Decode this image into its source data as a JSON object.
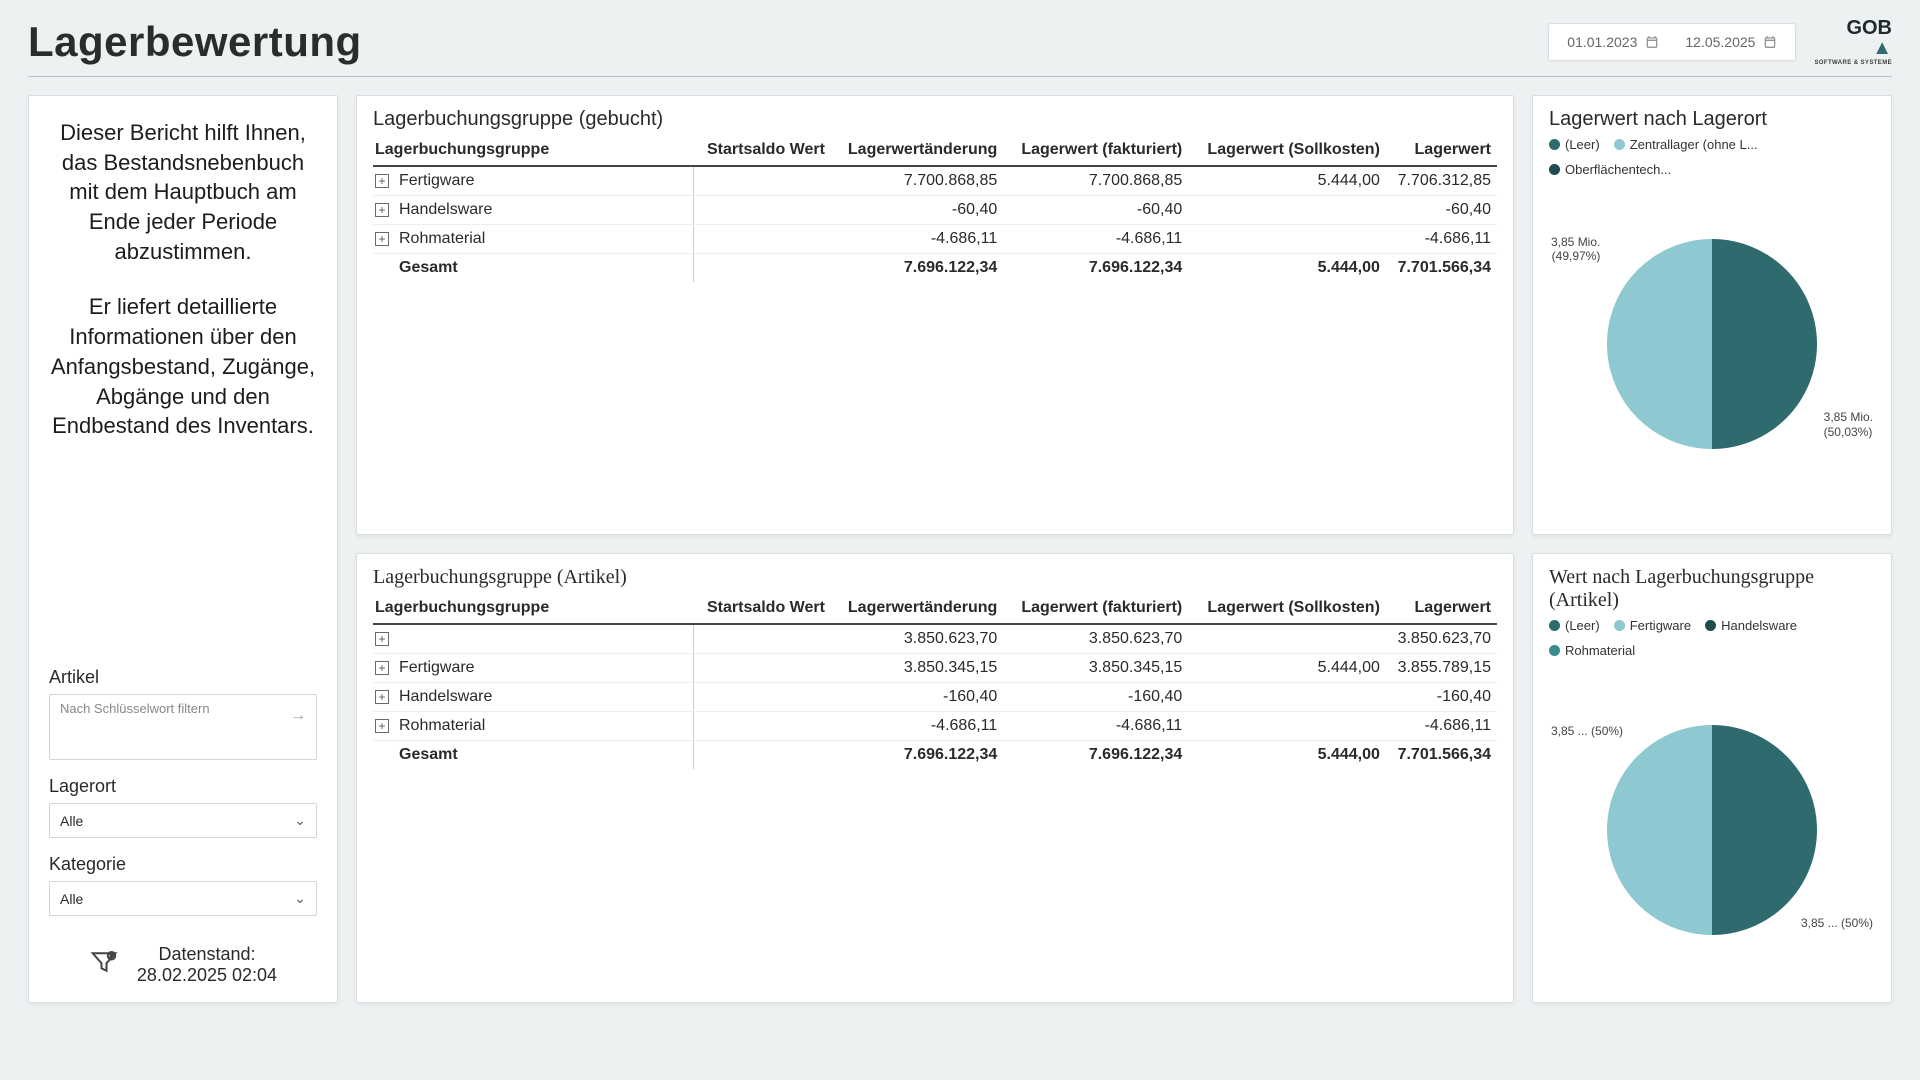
{
  "header": {
    "title": "Lagerbewertung",
    "date_from": "01.01.2023",
    "date_to": "12.05.2025",
    "logo_main": "GOB",
    "logo_sub": "SOFTWARE & SYSTEME"
  },
  "sidebar": {
    "para1": "Dieser Bericht hilft Ihnen, das Bestandsnebenbuch mit dem Hauptbuch am Ende jeder Periode abzustimmen.",
    "para2": "Er liefert detaillierte Informationen über den Anfangsbestand, Zugänge, Abgänge und den Endbestand des Inventars.",
    "article_label": "Artikel",
    "article_placeholder": "Nach Schlüsselwort filtern",
    "location_label": "Lagerort",
    "location_value": "Alle",
    "category_label": "Kategorie",
    "category_value": "Alle",
    "datastand_label": "Datenstand:",
    "datastand_value": "28.02.2025 02:04"
  },
  "table_booked": {
    "title": "Lagerbuchungsgruppe (gebucht)",
    "headers": {
      "group": "Lagerbuchungsgruppe",
      "start": "Startsaldo Wert",
      "change": "Lagerwertänderung",
      "invoiced": "Lagerwert (fakturiert)",
      "target": "Lagerwert (Sollkosten)",
      "total": "Lagerwert"
    },
    "rows": [
      {
        "name": "Fertigware",
        "start": "",
        "change": "7.700.868,85",
        "invoiced": "7.700.868,85",
        "target": "5.444,00",
        "total": "7.706.312,85"
      },
      {
        "name": "Handelsware",
        "start": "",
        "change": "-60,40",
        "invoiced": "-60,40",
        "target": "",
        "total": "-60,40"
      },
      {
        "name": "Rohmaterial",
        "start": "",
        "change": "-4.686,11",
        "invoiced": "-4.686,11",
        "target": "",
        "total": "-4.686,11"
      }
    ],
    "total_row": {
      "name": "Gesamt",
      "start": "",
      "change": "7.696.122,34",
      "invoiced": "7.696.122,34",
      "target": "5.444,00",
      "total": "7.701.566,34"
    }
  },
  "table_article": {
    "title": "Lagerbuchungsgruppe (Artikel)",
    "headers": {
      "group": "Lagerbuchungsgruppe",
      "start": "Startsaldo Wert",
      "change": "Lagerwertänderung",
      "invoiced": "Lagerwert (fakturiert)",
      "target": "Lagerwert (Sollkosten)",
      "total": "Lagerwert"
    },
    "rows": [
      {
        "name": "",
        "start": "",
        "change": "3.850.623,70",
        "invoiced": "3.850.623,70",
        "target": "",
        "total": "3.850.623,70"
      },
      {
        "name": "Fertigware",
        "start": "",
        "change": "3.850.345,15",
        "invoiced": "3.850.345,15",
        "target": "5.444,00",
        "total": "3.855.789,15"
      },
      {
        "name": "Handelsware",
        "start": "",
        "change": "-160,40",
        "invoiced": "-160,40",
        "target": "",
        "total": "-160,40"
      },
      {
        "name": "Rohmaterial",
        "start": "",
        "change": "-4.686,11",
        "invoiced": "-4.686,11",
        "target": "",
        "total": "-4.686,11"
      }
    ],
    "total_row": {
      "name": "Gesamt",
      "start": "",
      "change": "7.696.122,34",
      "invoiced": "7.696.122,34",
      "target": "5.444,00",
      "total": "7.701.566,34"
    }
  },
  "pie_location": {
    "title": "Lagerwert nach Lagerort",
    "legend": [
      {
        "label": "(Leer)",
        "color": "#2f6b6e"
      },
      {
        "label": "Zentrallager (ohne L...",
        "color": "#8ec8d0"
      },
      {
        "label": "Oberflächentech...",
        "color": "#1f4c4f"
      }
    ],
    "label_left_1": "3,85 Mio.",
    "label_left_2": "(49,97%)",
    "label_right_1": "3,85 Mio.",
    "label_right_2": "(50,03%)",
    "colors": {
      "a": "#2f6b6e",
      "b": "#8ec8d0"
    },
    "split": 50.03
  },
  "pie_group": {
    "title": "Wert nach Lagerbuchungsgruppe (Artikel)",
    "legend": [
      {
        "label": "(Leer)",
        "color": "#2f6b6e"
      },
      {
        "label": "Fertigware",
        "color": "#8ec8d0"
      },
      {
        "label": "Handelsware",
        "color": "#1f4c4f"
      },
      {
        "label": "Rohmaterial",
        "color": "#3a8a90"
      }
    ],
    "label_left_1": "3,85 ... (50%)",
    "label_left_2": "",
    "label_right_1": "3,85 ... (50%)",
    "label_right_2": "",
    "colors": {
      "a": "#2f6b6e",
      "b": "#8ec8d0"
    },
    "split": 50
  },
  "chart_data": [
    {
      "type": "pie",
      "title": "Lagerwert nach Lagerort",
      "series": [
        {
          "name": "(Leer)",
          "value": 3850000,
          "pct": 50.03
        },
        {
          "name": "Zentrallager (ohne L...)",
          "value": 3850000,
          "pct": 49.97
        },
        {
          "name": "Oberflächentech...",
          "value": 0,
          "pct": 0
        }
      ],
      "value_unit": "Mio."
    },
    {
      "type": "pie",
      "title": "Wert nach Lagerbuchungsgruppe (Artikel)",
      "series": [
        {
          "name": "(Leer)",
          "value": 3850000,
          "pct": 50
        },
        {
          "name": "Fertigware",
          "value": 3850000,
          "pct": 50
        },
        {
          "name": "Handelsware",
          "value": 0,
          "pct": 0
        },
        {
          "name": "Rohmaterial",
          "value": 0,
          "pct": 0
        }
      ]
    }
  ]
}
